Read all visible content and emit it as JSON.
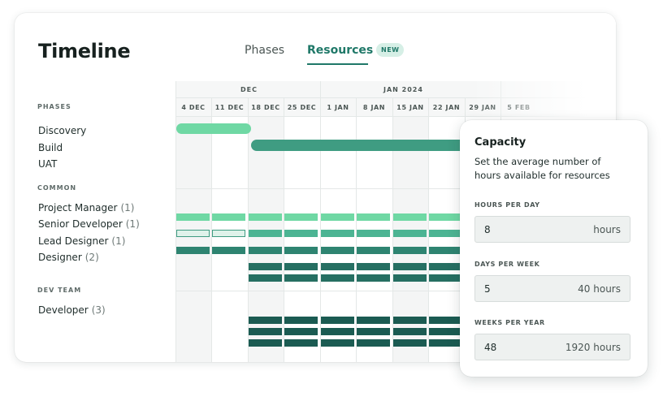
{
  "header": {
    "title": "Timeline",
    "tabs": [
      {
        "label": "Phases",
        "active": false
      },
      {
        "label": "Resources",
        "active": true,
        "badge": "NEW"
      }
    ]
  },
  "timeline": {
    "months": [
      "DEC",
      "JAN 2024"
    ],
    "weeks": [
      "4 DEC",
      "11 DEC",
      "18 DEC",
      "25 DEC",
      "1 JAN",
      "8 JAN",
      "15 JAN",
      "22 JAN",
      "29 JAN",
      "5 FEB"
    ],
    "sections": [
      {
        "label": "PHASES",
        "rows": [
          {
            "name": "Discovery",
            "count": ""
          },
          {
            "name": "Build",
            "count": ""
          },
          {
            "name": "UAT",
            "count": ""
          }
        ]
      },
      {
        "label": "COMMON",
        "rows": [
          {
            "name": "Project Manager",
            "count": "(1)"
          },
          {
            "name": "Senior Developer",
            "count": "(1)"
          },
          {
            "name": "Lead Designer",
            "count": "(1)"
          },
          {
            "name": "Designer",
            "count": "(2)"
          }
        ]
      },
      {
        "label": "DEV TEAM",
        "rows": [
          {
            "name": "Developer",
            "count": "(3)"
          }
        ]
      }
    ]
  },
  "capacity": {
    "title": "Capacity",
    "description": "Set the average number of hours available for resources",
    "fields": [
      {
        "label": "HOURS PER DAY",
        "value": "8",
        "unit": "hours"
      },
      {
        "label": "DAYS PER WEEK",
        "value": "5",
        "unit": "40 hours"
      },
      {
        "label": "WEEKS PER YEAR",
        "value": "48",
        "unit": "1920 hours"
      }
    ]
  },
  "colors": {
    "accent": "#1f7868",
    "light_green": "#6fd8a4",
    "mid_green": "#3f9c82",
    "dark_green": "#2e8471",
    "darkest_green": "#1b5b52"
  }
}
